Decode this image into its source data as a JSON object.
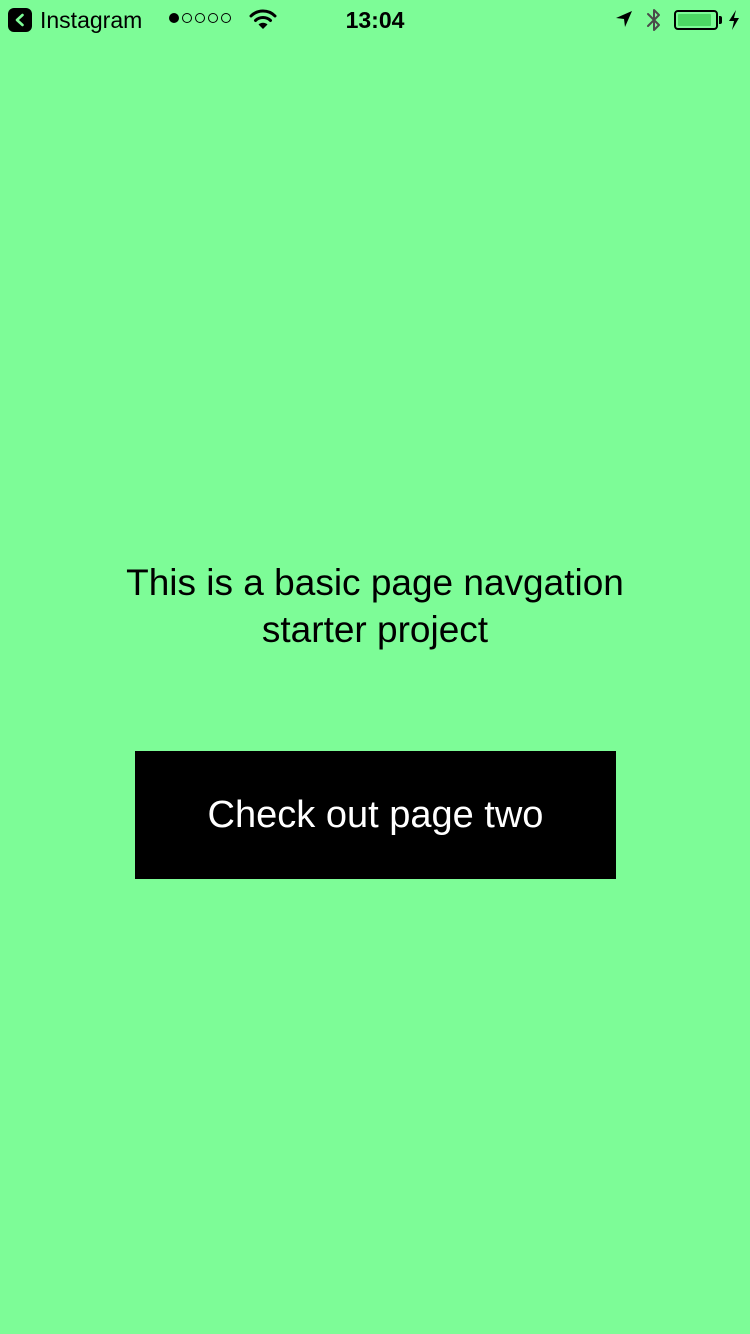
{
  "status_bar": {
    "back_app_label": "Instagram",
    "back_icon": "chevron-left-icon",
    "signal_strength": {
      "filled": 1,
      "total": 5
    },
    "wifi_icon": "wifi-icon",
    "time": "13:04",
    "location_icon": "location-arrow-icon",
    "bluetooth_icon": "bluetooth-icon",
    "battery_level": 0.92,
    "charging_icon": "bolt-icon",
    "battery_color": "#4cd964"
  },
  "content": {
    "intro_text": "This is a basic page navgation starter project",
    "button_label": "Check out page two"
  },
  "colors": {
    "background": "#7dfc97",
    "button_background": "#000000",
    "button_text": "#ffffff"
  }
}
